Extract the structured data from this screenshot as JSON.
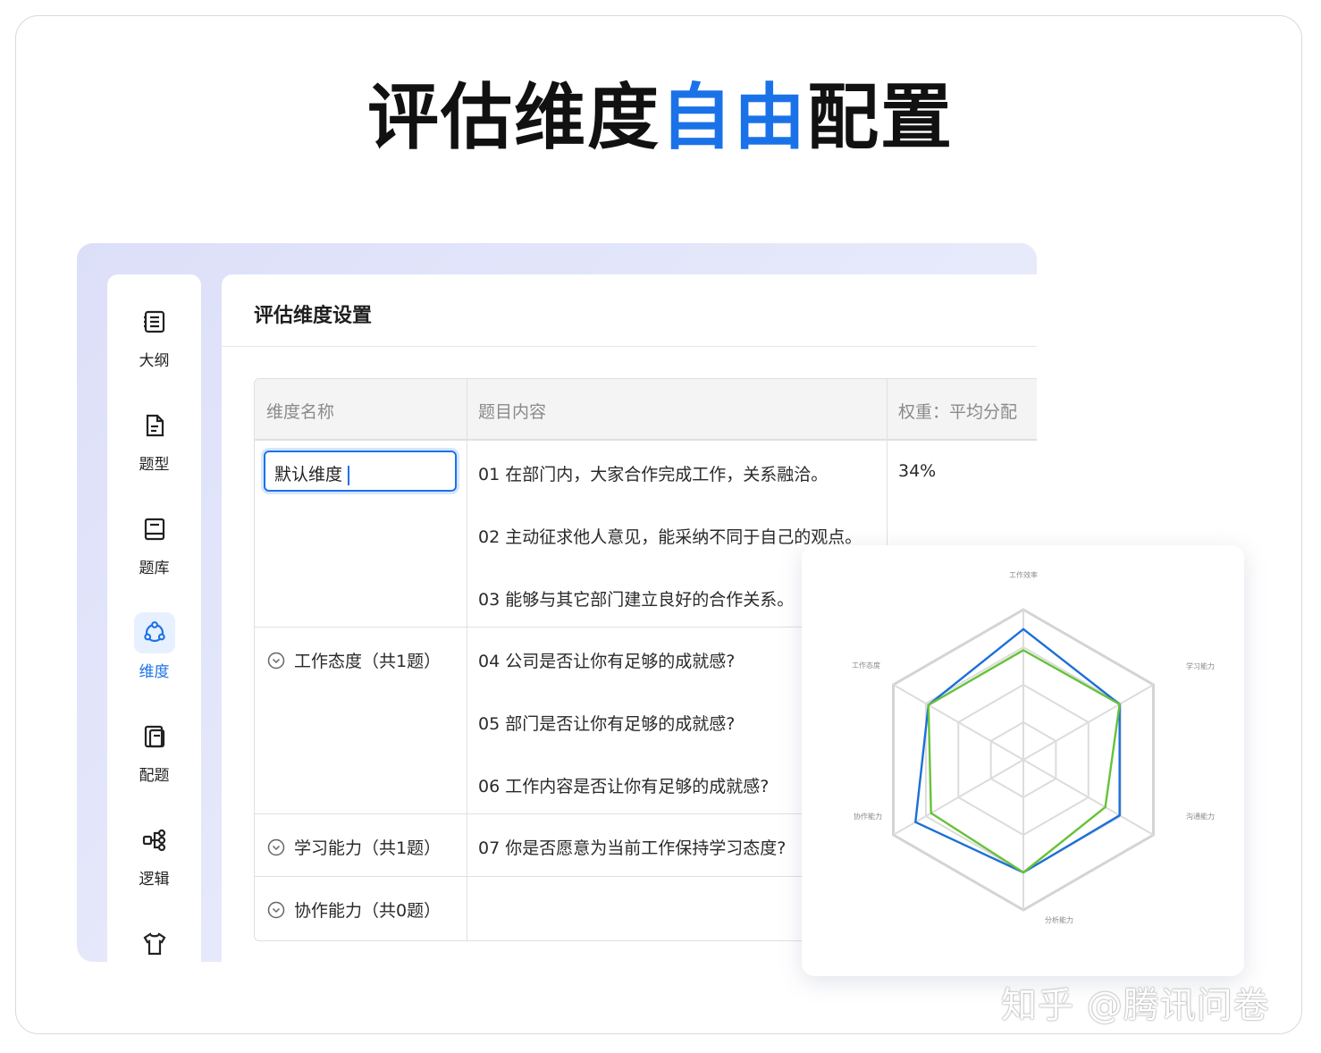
{
  "headline": {
    "part1": "评估维度",
    "accent": "自由",
    "part2": "配置"
  },
  "sidebar": {
    "items": [
      {
        "label": "大纲",
        "icon": "outline-icon"
      },
      {
        "label": "题型",
        "icon": "question-type-icon"
      },
      {
        "label": "题库",
        "icon": "question-bank-icon"
      },
      {
        "label": "维度",
        "icon": "dimension-icon",
        "active": true
      },
      {
        "label": "配题",
        "icon": "assign-questions-icon"
      },
      {
        "label": "逻辑",
        "icon": "logic-icon"
      },
      {
        "label": "",
        "icon": "shirt-icon"
      }
    ]
  },
  "main": {
    "title": "评估维度设置",
    "table": {
      "headers": [
        "维度名称",
        "题目内容",
        "权重：平均分配"
      ],
      "rows": [
        {
          "dimension_input": "默认维度",
          "questions": [
            "01 在部门内，大家合作完成工作，关系融洽。",
            "02 主动征求他人意见，能采纳不同于自己的观点。",
            "03 能够与其它部门建立良好的合作关系。"
          ],
          "weight": "34%"
        },
        {
          "dimension": "工作态度（共1题）",
          "questions": [
            "04 公司是否让你有足够的成就感?",
            "05 部门是否让你有足够的成就感?",
            "06 工作内容是否让你有足够的成就感?"
          ]
        },
        {
          "dimension": "学习能力（共1题）",
          "questions": [
            "07 你是否愿意为当前工作保持学习态度?"
          ]
        },
        {
          "dimension": "协作能力（共0题）",
          "questions": []
        }
      ]
    }
  },
  "chart_data": {
    "type": "radar",
    "axes": [
      "工作效率",
      "学习能力",
      "沟通能力",
      "分析能力",
      "协作能力",
      "工作态度"
    ],
    "max": 1,
    "rings": 4,
    "series": [
      {
        "values": [
          0.87,
          0.74,
          0.74,
          0.75,
          0.83,
          0.73
        ],
        "color": "#1b6fd8"
      },
      {
        "values": [
          0.73,
          0.74,
          0.63,
          0.75,
          0.71,
          0.73
        ],
        "color": "#67c23a"
      }
    ]
  },
  "watermark": "知乎 @腾讯问卷"
}
